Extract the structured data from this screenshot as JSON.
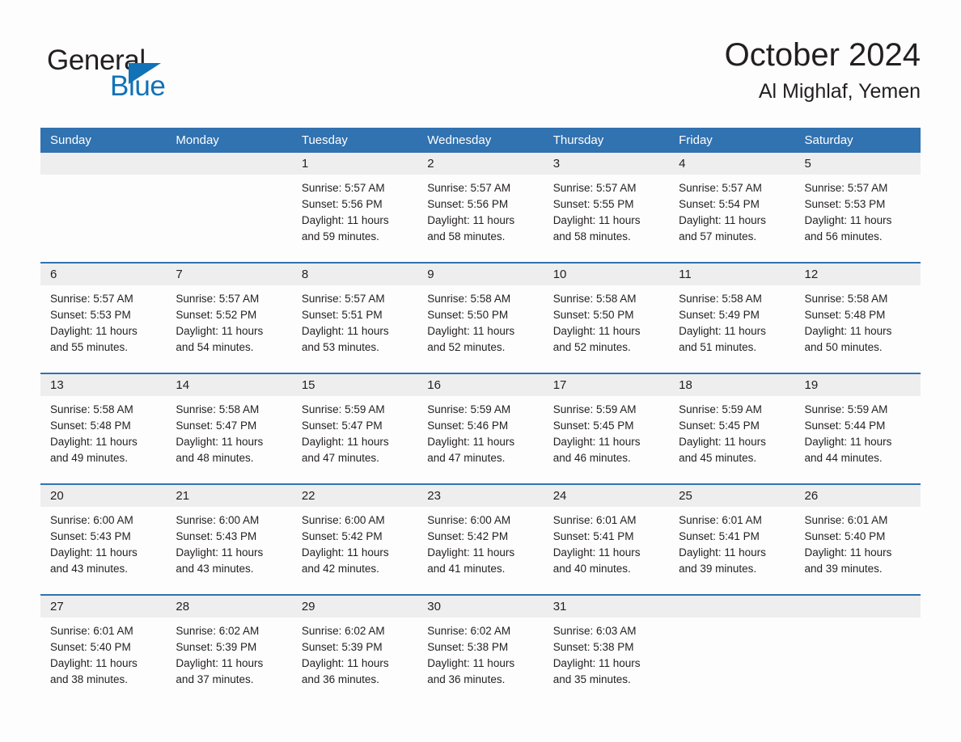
{
  "logo": {
    "word_one": "General",
    "word_two": "Blue",
    "triangle_color": "#1272b6"
  },
  "header": {
    "title": "October 2024",
    "subtitle": "Al Mighlaf, Yemen"
  },
  "theme": {
    "header_blue": "#3172b0",
    "daynum_band": "#eeeeee",
    "text": "#231f20",
    "page_background": "#fdfdfd"
  },
  "calendar": {
    "day_headers": [
      "Sunday",
      "Monday",
      "Tuesday",
      "Wednesday",
      "Thursday",
      "Friday",
      "Saturday"
    ],
    "weeks": [
      {
        "days": [
          {
            "num": "",
            "lines": [
              "",
              "",
              "",
              ""
            ]
          },
          {
            "num": "",
            "lines": [
              "",
              "",
              "",
              ""
            ]
          },
          {
            "num": "1",
            "lines": [
              "Sunrise: 5:57 AM",
              "Sunset: 5:56 PM",
              "Daylight: 11 hours",
              "and 59 minutes."
            ]
          },
          {
            "num": "2",
            "lines": [
              "Sunrise: 5:57 AM",
              "Sunset: 5:56 PM",
              "Daylight: 11 hours",
              "and 58 minutes."
            ]
          },
          {
            "num": "3",
            "lines": [
              "Sunrise: 5:57 AM",
              "Sunset: 5:55 PM",
              "Daylight: 11 hours",
              "and 58 minutes."
            ]
          },
          {
            "num": "4",
            "lines": [
              "Sunrise: 5:57 AM",
              "Sunset: 5:54 PM",
              "Daylight: 11 hours",
              "and 57 minutes."
            ]
          },
          {
            "num": "5",
            "lines": [
              "Sunrise: 5:57 AM",
              "Sunset: 5:53 PM",
              "Daylight: 11 hours",
              "and 56 minutes."
            ]
          }
        ]
      },
      {
        "days": [
          {
            "num": "6",
            "lines": [
              "Sunrise: 5:57 AM",
              "Sunset: 5:53 PM",
              "Daylight: 11 hours",
              "and 55 minutes."
            ]
          },
          {
            "num": "7",
            "lines": [
              "Sunrise: 5:57 AM",
              "Sunset: 5:52 PM",
              "Daylight: 11 hours",
              "and 54 minutes."
            ]
          },
          {
            "num": "8",
            "lines": [
              "Sunrise: 5:57 AM",
              "Sunset: 5:51 PM",
              "Daylight: 11 hours",
              "and 53 minutes."
            ]
          },
          {
            "num": "9",
            "lines": [
              "Sunrise: 5:58 AM",
              "Sunset: 5:50 PM",
              "Daylight: 11 hours",
              "and 52 minutes."
            ]
          },
          {
            "num": "10",
            "lines": [
              "Sunrise: 5:58 AM",
              "Sunset: 5:50 PM",
              "Daylight: 11 hours",
              "and 52 minutes."
            ]
          },
          {
            "num": "11",
            "lines": [
              "Sunrise: 5:58 AM",
              "Sunset: 5:49 PM",
              "Daylight: 11 hours",
              "and 51 minutes."
            ]
          },
          {
            "num": "12",
            "lines": [
              "Sunrise: 5:58 AM",
              "Sunset: 5:48 PM",
              "Daylight: 11 hours",
              "and 50 minutes."
            ]
          }
        ]
      },
      {
        "days": [
          {
            "num": "13",
            "lines": [
              "Sunrise: 5:58 AM",
              "Sunset: 5:48 PM",
              "Daylight: 11 hours",
              "and 49 minutes."
            ]
          },
          {
            "num": "14",
            "lines": [
              "Sunrise: 5:58 AM",
              "Sunset: 5:47 PM",
              "Daylight: 11 hours",
              "and 48 minutes."
            ]
          },
          {
            "num": "15",
            "lines": [
              "Sunrise: 5:59 AM",
              "Sunset: 5:47 PM",
              "Daylight: 11 hours",
              "and 47 minutes."
            ]
          },
          {
            "num": "16",
            "lines": [
              "Sunrise: 5:59 AM",
              "Sunset: 5:46 PM",
              "Daylight: 11 hours",
              "and 47 minutes."
            ]
          },
          {
            "num": "17",
            "lines": [
              "Sunrise: 5:59 AM",
              "Sunset: 5:45 PM",
              "Daylight: 11 hours",
              "and 46 minutes."
            ]
          },
          {
            "num": "18",
            "lines": [
              "Sunrise: 5:59 AM",
              "Sunset: 5:45 PM",
              "Daylight: 11 hours",
              "and 45 minutes."
            ]
          },
          {
            "num": "19",
            "lines": [
              "Sunrise: 5:59 AM",
              "Sunset: 5:44 PM",
              "Daylight: 11 hours",
              "and 44 minutes."
            ]
          }
        ]
      },
      {
        "days": [
          {
            "num": "20",
            "lines": [
              "Sunrise: 6:00 AM",
              "Sunset: 5:43 PM",
              "Daylight: 11 hours",
              "and 43 minutes."
            ]
          },
          {
            "num": "21",
            "lines": [
              "Sunrise: 6:00 AM",
              "Sunset: 5:43 PM",
              "Daylight: 11 hours",
              "and 43 minutes."
            ]
          },
          {
            "num": "22",
            "lines": [
              "Sunrise: 6:00 AM",
              "Sunset: 5:42 PM",
              "Daylight: 11 hours",
              "and 42 minutes."
            ]
          },
          {
            "num": "23",
            "lines": [
              "Sunrise: 6:00 AM",
              "Sunset: 5:42 PM",
              "Daylight: 11 hours",
              "and 41 minutes."
            ]
          },
          {
            "num": "24",
            "lines": [
              "Sunrise: 6:01 AM",
              "Sunset: 5:41 PM",
              "Daylight: 11 hours",
              "and 40 minutes."
            ]
          },
          {
            "num": "25",
            "lines": [
              "Sunrise: 6:01 AM",
              "Sunset: 5:41 PM",
              "Daylight: 11 hours",
              "and 39 minutes."
            ]
          },
          {
            "num": "26",
            "lines": [
              "Sunrise: 6:01 AM",
              "Sunset: 5:40 PM",
              "Daylight: 11 hours",
              "and 39 minutes."
            ]
          }
        ]
      },
      {
        "days": [
          {
            "num": "27",
            "lines": [
              "Sunrise: 6:01 AM",
              "Sunset: 5:40 PM",
              "Daylight: 11 hours",
              "and 38 minutes."
            ]
          },
          {
            "num": "28",
            "lines": [
              "Sunrise: 6:02 AM",
              "Sunset: 5:39 PM",
              "Daylight: 11 hours",
              "and 37 minutes."
            ]
          },
          {
            "num": "29",
            "lines": [
              "Sunrise: 6:02 AM",
              "Sunset: 5:39 PM",
              "Daylight: 11 hours",
              "and 36 minutes."
            ]
          },
          {
            "num": "30",
            "lines": [
              "Sunrise: 6:02 AM",
              "Sunset: 5:38 PM",
              "Daylight: 11 hours",
              "and 36 minutes."
            ]
          },
          {
            "num": "31",
            "lines": [
              "Sunrise: 6:03 AM",
              "Sunset: 5:38 PM",
              "Daylight: 11 hours",
              "and 35 minutes."
            ]
          },
          {
            "num": "",
            "lines": [
              "",
              "",
              "",
              ""
            ]
          },
          {
            "num": "",
            "lines": [
              "",
              "",
              "",
              ""
            ]
          }
        ]
      }
    ]
  }
}
